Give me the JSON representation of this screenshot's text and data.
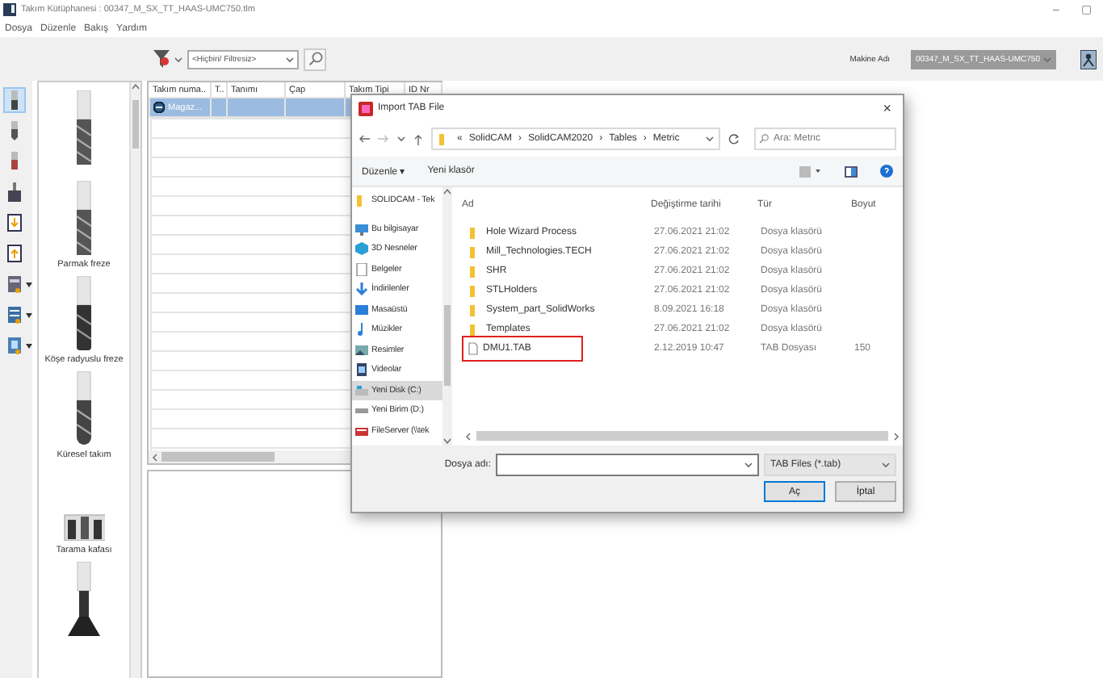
{
  "window": {
    "title": "Takım Kütüphanesi : 00347_M_SX_TT_HAAS-UMC750.tlm",
    "controls": [
      "–",
      "▢"
    ]
  },
  "menu": [
    "Dosya",
    "Düzenle",
    "Bakış",
    "Yardım"
  ],
  "toolbar": {
    "filter": {
      "value": "<Hiçbiri/ Filtresiz>"
    },
    "machine_label": "Makine Adı",
    "machine": {
      "value": "00347_M_SX_TT_HAAS-UMC750",
      "disabled": true
    }
  },
  "side_tools": [
    {
      "kind": "mill",
      "selected": true,
      "has_menu": false
    },
    {
      "kind": "drill",
      "selected": false,
      "has_menu": false
    },
    {
      "kind": "tap",
      "selected": false,
      "has_menu": false
    },
    {
      "kind": "holder",
      "selected": false,
      "has_menu": false
    },
    {
      "kind": "import",
      "selected": false,
      "has_menu": false
    },
    {
      "kind": "export",
      "selected": false,
      "has_menu": false
    },
    {
      "kind": "table",
      "selected": false,
      "has_menu": true
    },
    {
      "kind": "list",
      "selected": false,
      "has_menu": true
    },
    {
      "kind": "sheet",
      "selected": false,
      "has_menu": true
    }
  ],
  "gallery": [
    {
      "kind": "endmill"
    },
    {
      "kind": "endmill",
      "label": "Parmak freze"
    },
    {
      "kind": "radius",
      "label": "Köşe radyuslu freze"
    },
    {
      "kind": "ball",
      "label": "Küresel takım"
    },
    {
      "kind": "facemill",
      "label": "Tarama kafası"
    },
    {
      "kind": "tslot"
    }
  ],
  "table": {
    "columns": [
      "Takım numa..",
      "T..",
      "Tanımı",
      "Çap",
      "Takım Tipi",
      "ID Nr"
    ],
    "rows": [
      {
        "cells": [
          "Magaz...",
          "",
          "",
          "",
          "",
          ""
        ],
        "selected": true
      }
    ]
  },
  "dialog": {
    "title": "Import TAB File",
    "close": "×",
    "path": [
      "«",
      "SolidCAM",
      "›",
      "SolidCAM2020",
      "›",
      "Tables",
      "›",
      "Metric"
    ],
    "search": {
      "placeholder": "Ara: Metric"
    },
    "commands": [
      "Düzenle ▾",
      "Yeni klasör"
    ],
    "nav": [
      {
        "label": "SOLIDCAM - Tek",
        "kind": "folder",
        "selected": false
      },
      {
        "label": "Bu bilgisayar",
        "kind": "pc",
        "selected": false
      },
      {
        "label": "3D Nesneler",
        "kind": "cube",
        "selected": false
      },
      {
        "label": "Belgeler",
        "kind": "doc",
        "selected": false
      },
      {
        "label": "İndirilenler",
        "kind": "download",
        "selected": false
      },
      {
        "label": "Masaüstü",
        "kind": "desktop",
        "selected": false
      },
      {
        "label": "Müzikler",
        "kind": "music",
        "selected": false
      },
      {
        "label": "Resimler",
        "kind": "image",
        "selected": false
      },
      {
        "label": "Videolar",
        "kind": "video",
        "selected": false
      },
      {
        "label": "Yeni Disk (C:)",
        "kind": "disk",
        "selected": true
      },
      {
        "label": "Yeni Birim (D:)",
        "kind": "drive",
        "selected": false
      },
      {
        "label": "FileServer (\\\\tek",
        "kind": "network",
        "selected": false
      }
    ],
    "columns": [
      "Ad",
      "Değiştirme tarihi",
      "Tür",
      "Boyut"
    ],
    "files": [
      {
        "name": "Hole Wizard Process",
        "date": "27.06.2021 21:02",
        "type": "Dosya klasörü",
        "kind": "folder",
        "highlighted": false
      },
      {
        "name": "Mill_Technologies.TECH",
        "date": "27.06.2021 21:02",
        "type": "Dosya klasörü",
        "kind": "folder",
        "highlighted": false
      },
      {
        "name": "SHR",
        "date": "27.06.2021 21:02",
        "type": "Dosya klasörü",
        "kind": "folder",
        "highlighted": false
      },
      {
        "name": "STLHolders",
        "date": "27.06.2021 21:02",
        "type": "Dosya klasörü",
        "kind": "folder",
        "highlighted": false
      },
      {
        "name": "System_part_SolidWorks",
        "date": "8.09.2021 16:18",
        "type": "Dosya klasörü",
        "kind": "folder",
        "highlighted": false
      },
      {
        "name": "Templates",
        "date": "27.06.2021 21:02",
        "type": "Dosya klasörü",
        "kind": "folder",
        "highlighted": false
      },
      {
        "name": "DMU1.TAB",
        "date": "2.12.2019 10:47",
        "type": "TAB Dosyası",
        "size": "150",
        "kind": "file",
        "highlighted": true
      }
    ],
    "filename_label": "Dosya adı:",
    "filetype": "TAB Files (*.tab)",
    "buttons": [
      "Aç",
      "İptal"
    ]
  }
}
